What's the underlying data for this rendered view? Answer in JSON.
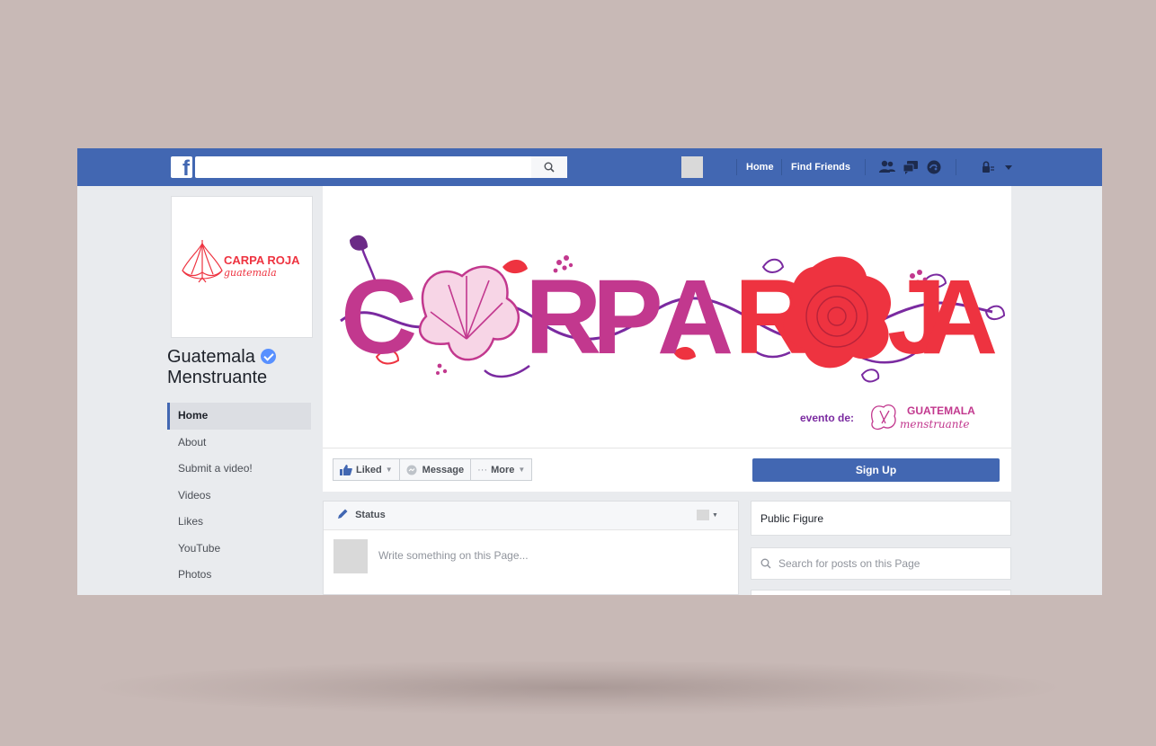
{
  "topbar": {
    "logo_letter": "f",
    "search": {
      "placeholder": ""
    },
    "nav": {
      "home": "Home",
      "find_friends": "Find Friends"
    },
    "icons": [
      "friend-requests-icon",
      "messages-icon",
      "notifications-icon",
      "privacy-shortcuts-icon",
      "account-menu-chevron-icon"
    ]
  },
  "page": {
    "name_line1": "Guatemala",
    "name_line2": "Menstruante",
    "profile_logo": {
      "title": "CARPA ROJA",
      "subtitle": "guatemala"
    }
  },
  "sidebar": {
    "items": [
      {
        "label": "Home",
        "active": true
      },
      {
        "label": "About"
      },
      {
        "label": "Submit a video!"
      },
      {
        "label": "Videos"
      },
      {
        "label": "Likes"
      },
      {
        "label": "YouTube"
      },
      {
        "label": "Photos"
      }
    ]
  },
  "cover": {
    "letters": [
      "C",
      "R",
      "P",
      "A",
      "R",
      "J",
      "A"
    ],
    "credit_label": "evento de:",
    "credit_org_line1": "GUATEMALA",
    "credit_org_line2": "menstruante"
  },
  "actions": {
    "liked": "Liked",
    "message": "Message",
    "more_prefix": "···",
    "more": "More",
    "signup": "Sign Up"
  },
  "composer": {
    "tab": "Status",
    "placeholder": "Write something on this Page..."
  },
  "right": {
    "category": "Public Figure",
    "search_placeholder": "Search for posts on this Page"
  },
  "colors": {
    "facebook_blue": "#4267b2",
    "carpa_magenta": "#c2388e",
    "carpa_red": "#ee3340",
    "carpa_purple": "#7a2aa0",
    "background": "#c8b9b6"
  }
}
